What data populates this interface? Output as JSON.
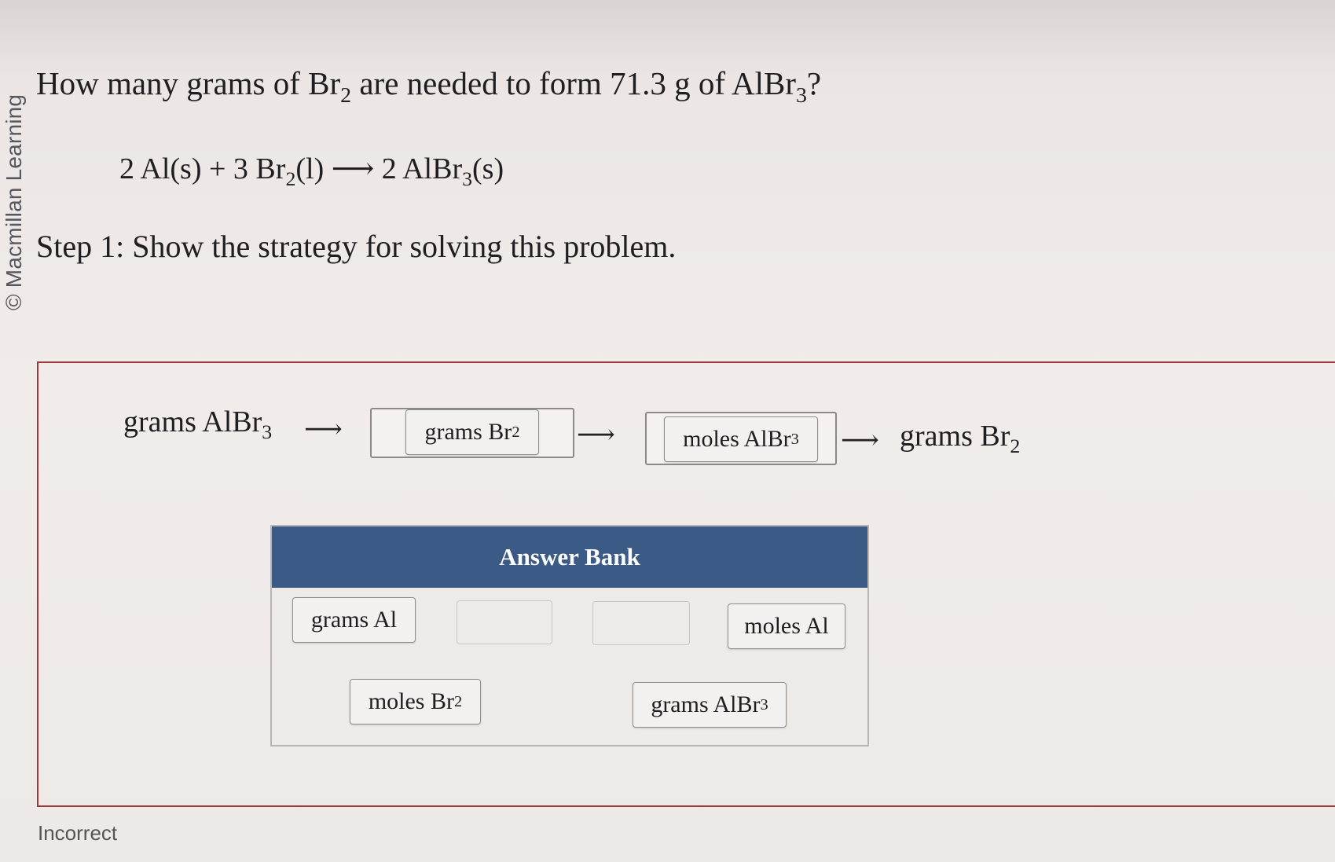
{
  "watermark": "© Macmillan Learning",
  "question": {
    "pre": "How many grams of Br",
    "sub1": "2",
    "mid": " are needed to form 71.3 g of AlBr",
    "sub2": "3",
    "post": "?"
  },
  "equation": {
    "t1": "2 Al(s) + 3 Br",
    "s1": "2",
    "t2": "(l) ⟶ 2 AlBr",
    "s2": "3",
    "t3": "(s)"
  },
  "step": "Step 1: Show the strategy for solving this problem.",
  "chain": {
    "start": {
      "text": "grams AlBr",
      "sub": "3"
    },
    "arrow": "⟶",
    "slot1": {
      "text": "grams Br",
      "sub": "2"
    },
    "slot2": {
      "text": "moles AlBr",
      "sub": "3"
    },
    "end": {
      "text": "grams Br",
      "sub": "2"
    }
  },
  "answer_bank": {
    "title": "Answer Bank",
    "items": [
      {
        "text": "grams Al",
        "sub": ""
      },
      {
        "text": "moles Al",
        "sub": ""
      },
      {
        "text": "moles Br",
        "sub": "2"
      },
      {
        "text": "grams AlBr",
        "sub": "3"
      }
    ]
  },
  "status": "Incorrect"
}
